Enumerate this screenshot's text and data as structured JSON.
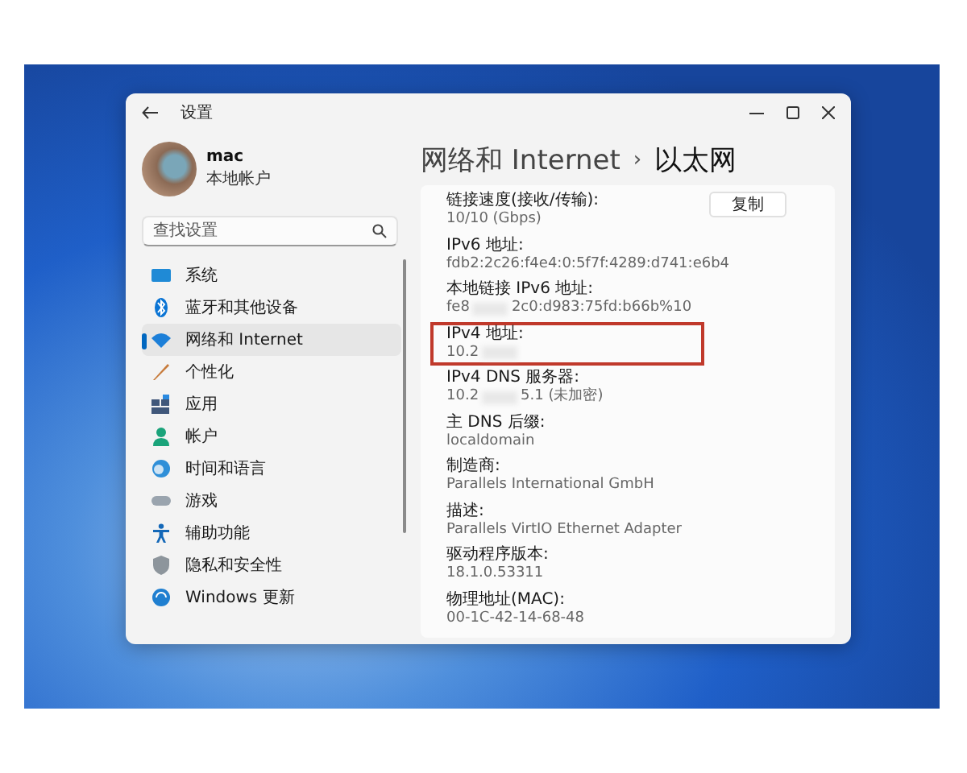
{
  "window": {
    "title": "设置"
  },
  "account": {
    "name": "mac",
    "type": "本地帐户"
  },
  "search": {
    "placeholder": "查找设置"
  },
  "nav": [
    {
      "label": "系统",
      "selected": false
    },
    {
      "label": "蓝牙和其他设备",
      "selected": false
    },
    {
      "label": "网络和 Internet",
      "selected": true
    },
    {
      "label": "个性化",
      "selected": false
    },
    {
      "label": "应用",
      "selected": false
    },
    {
      "label": "帐户",
      "selected": false
    },
    {
      "label": "时间和语言",
      "selected": false
    },
    {
      "label": "游戏",
      "selected": false
    },
    {
      "label": "辅助功能",
      "selected": false
    },
    {
      "label": "隐私和安全性",
      "selected": false
    },
    {
      "label": "Windows 更新",
      "selected": false
    }
  ],
  "breadcrumb": {
    "parent": "网络和 Internet",
    "separator": "›",
    "current": "以太网"
  },
  "copy_button": "复制",
  "details": [
    {
      "label": "链接速度(接收/传输):",
      "value": "10/10 (Gbps)",
      "highlighted": false
    },
    {
      "label": "IPv6 地址:",
      "value": "fdb2:2c26:f4e4:0:5f7f:4289:d741:e6b4",
      "highlighted": false
    },
    {
      "label": "本地链接 IPv6 地址:",
      "value": "fe8",
      "masked": true,
      "value_after": "2c0:d983:75fd:b66b%10",
      "highlighted": false
    },
    {
      "label": "IPv4 地址:",
      "value": "10.2",
      "masked": true,
      "highlighted": true
    },
    {
      "label": "IPv4 DNS 服务器:",
      "value": "10.2",
      "masked": true,
      "value_after": "5.1 (未加密)",
      "highlighted": false
    },
    {
      "label": "主 DNS 后缀:",
      "value": "localdomain",
      "highlighted": false
    },
    {
      "label": "制造商:",
      "value": "Parallels International GmbH",
      "highlighted": false
    },
    {
      "label": "描述:",
      "value": "Parallels VirtIO Ethernet Adapter",
      "highlighted": false
    },
    {
      "label": "驱动程序版本:",
      "value": "18.1.0.53311",
      "highlighted": false
    },
    {
      "label": "物理地址(MAC):",
      "value": "00-1C-42-14-68-48",
      "highlighted": false
    }
  ]
}
